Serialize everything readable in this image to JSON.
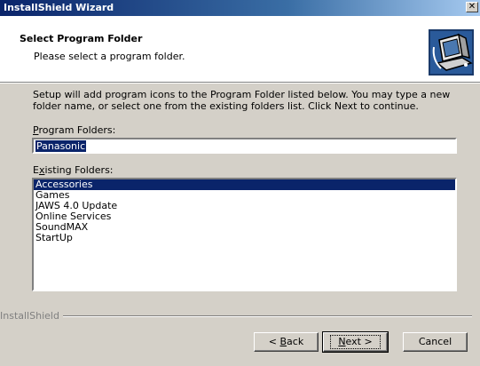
{
  "window": {
    "title": "InstallShield Wizard",
    "close_glyph": "✕"
  },
  "header": {
    "title": "Select Program Folder",
    "subtitle": "Please select a program folder.",
    "icon": "computer-installer-icon"
  },
  "description": "Setup will add program icons to the Program Folder listed below.  You may type a new folder name, or select one from the existing folders list.  Click Next to continue.",
  "program_folders": {
    "label_mnemonic": "P",
    "label_rest": "rogram Folders:",
    "value": "Panasonic"
  },
  "existing_folders": {
    "label_first": "E",
    "label_mnemonic": "x",
    "label_rest": "isting Folders:",
    "items": [
      "Accessories",
      "Games",
      "JAWS 4.0 Update",
      "Online Services",
      "SoundMAX",
      "StartUp"
    ],
    "selected_index": 0
  },
  "footer": {
    "brand": "InstallShield"
  },
  "buttons": {
    "back": {
      "prefix": "< ",
      "mnemonic": "B",
      "rest": "ack"
    },
    "next": {
      "mnemonic": "N",
      "rest": "ext >"
    },
    "cancel": {
      "label": "Cancel"
    }
  },
  "colors": {
    "face": "#d4d0c8",
    "selection": "#0a246a",
    "title_start": "#0a246a"
  }
}
